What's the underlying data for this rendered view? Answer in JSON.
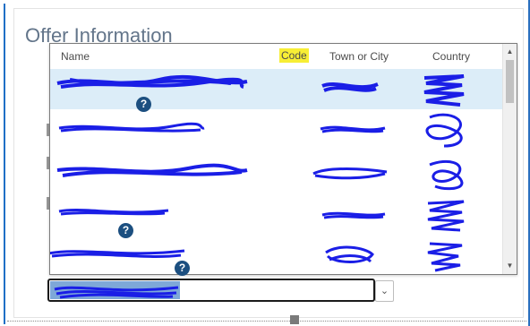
{
  "section": {
    "title": "Offer Information"
  },
  "list": {
    "columns": {
      "name": "Name",
      "code": "Code",
      "town": "Town or City",
      "country": "Country"
    },
    "rows": [
      {
        "name": "",
        "code": "",
        "town": "",
        "country": "",
        "help": "?"
      },
      {
        "name": "",
        "code": "",
        "town": "",
        "country": "",
        "help": ""
      },
      {
        "name": "",
        "code": "",
        "town": "",
        "country": "",
        "help": ""
      },
      {
        "name": "",
        "code": "",
        "town": "",
        "country": "",
        "help": "?"
      },
      {
        "name": "",
        "code": "",
        "town": "",
        "country": "",
        "help": "?"
      }
    ],
    "scroll_up_glyph": "▲",
    "scroll_down_glyph": "▼"
  },
  "combo": {
    "value": "",
    "chevron": "⌄"
  },
  "colors": {
    "accent": "#1f6fc6",
    "highlight": "#f7ee35",
    "selected_row": "#dcedf8",
    "scribble": "#1a1ee6"
  }
}
